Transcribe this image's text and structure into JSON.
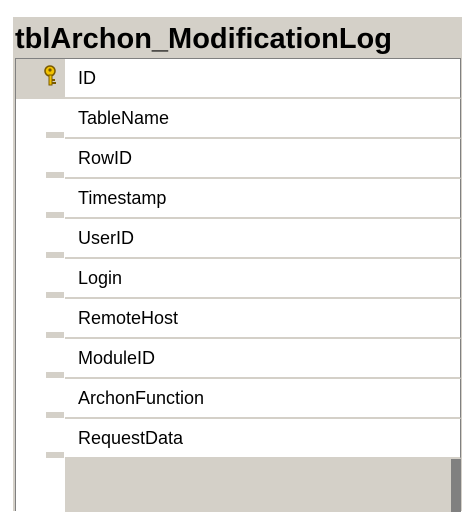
{
  "table": {
    "title": "tblArchon_ModificationLog",
    "fields": [
      {
        "name": "ID",
        "primary_key": true
      },
      {
        "name": "TableName",
        "primary_key": false
      },
      {
        "name": "RowID",
        "primary_key": false
      },
      {
        "name": "Timestamp",
        "primary_key": false
      },
      {
        "name": "UserID",
        "primary_key": false
      },
      {
        "name": "Login",
        "primary_key": false
      },
      {
        "name": "RemoteHost",
        "primary_key": false
      },
      {
        "name": "ModuleID",
        "primary_key": false
      },
      {
        "name": "ArchonFunction",
        "primary_key": false
      },
      {
        "name": "RequestData",
        "primary_key": false
      }
    ]
  },
  "colors": {
    "chrome": "#d4d0c8",
    "grid_line": "#808080",
    "key_gold": "#f2c200"
  },
  "icons": {
    "primary_key": "key-icon"
  }
}
